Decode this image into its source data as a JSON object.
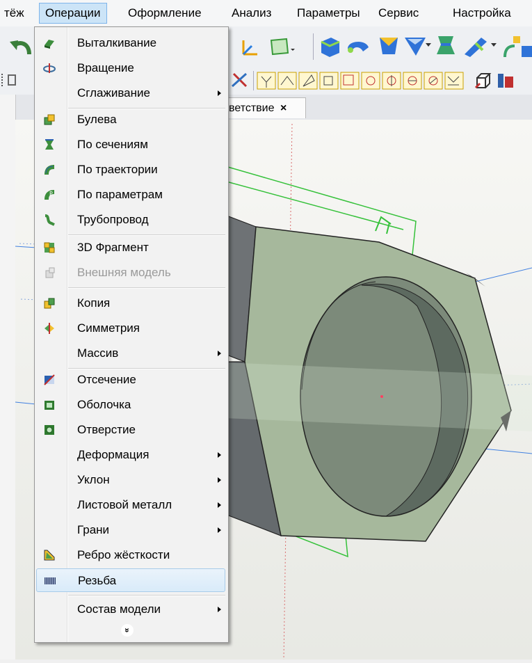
{
  "menubar": {
    "items": [
      "тёж",
      "Операции",
      "Оформление",
      "Анализ",
      "Параметры",
      "Сервис",
      "Настройка"
    ],
    "active_index": 1
  },
  "tab": {
    "label": "ветствие",
    "close": "×"
  },
  "menu": {
    "items": [
      {
        "label": "Выталкивание",
        "icon": "extrude-icon",
        "submenu": false,
        "disabled": false
      },
      {
        "label": "Вращение",
        "icon": "rotate-icon",
        "submenu": false,
        "disabled": false
      },
      {
        "label": "Сглаживание",
        "icon": "",
        "submenu": true,
        "disabled": false
      },
      {
        "label": "Булева",
        "icon": "boolean-icon",
        "submenu": false,
        "disabled": false
      },
      {
        "label": "По сечениям",
        "icon": "loft-icon",
        "submenu": false,
        "disabled": false
      },
      {
        "label": "По траектории",
        "icon": "sweep-icon",
        "submenu": false,
        "disabled": false
      },
      {
        "label": "По параметрам",
        "icon": "parametric-icon",
        "submenu": false,
        "disabled": false
      },
      {
        "label": "Трубопровод",
        "icon": "pipe-icon",
        "submenu": false,
        "disabled": false
      },
      {
        "label": "3D Фрагмент",
        "icon": "fragment-icon",
        "submenu": false,
        "disabled": false
      },
      {
        "label": "Внешняя модель",
        "icon": "external-model-icon",
        "submenu": false,
        "disabled": true
      },
      {
        "label": "Копия",
        "icon": "copy-icon",
        "submenu": false,
        "disabled": false
      },
      {
        "label": "Симметрия",
        "icon": "symmetry-icon",
        "submenu": false,
        "disabled": false
      },
      {
        "label": "Массив",
        "icon": "",
        "submenu": true,
        "disabled": false
      },
      {
        "label": "Отсечение",
        "icon": "cut-icon",
        "submenu": false,
        "disabled": false
      },
      {
        "label": "Оболочка",
        "icon": "shell-icon",
        "submenu": false,
        "disabled": false
      },
      {
        "label": "Отверстие",
        "icon": "hole-icon",
        "submenu": false,
        "disabled": false
      },
      {
        "label": "Деформация",
        "icon": "",
        "submenu": true,
        "disabled": false
      },
      {
        "label": "Уклон",
        "icon": "",
        "submenu": true,
        "disabled": false
      },
      {
        "label": "Листовой металл",
        "icon": "",
        "submenu": true,
        "disabled": false
      },
      {
        "label": "Грани",
        "icon": "",
        "submenu": true,
        "disabled": false
      },
      {
        "label": "Ребро жёсткости",
        "icon": "rib-icon",
        "submenu": false,
        "disabled": false
      },
      {
        "label": "Резьба",
        "icon": "thread-icon",
        "submenu": false,
        "disabled": false,
        "highlighted": true
      },
      {
        "label": "Состав модели",
        "icon": "",
        "submenu": true,
        "disabled": false
      }
    ],
    "more_glyph": "»"
  },
  "colors": {
    "accent": "#cce4f7",
    "model_fill": "#a6b89c",
    "sketch_line": "#35c13a",
    "axis_line": "#3f7fe0"
  }
}
